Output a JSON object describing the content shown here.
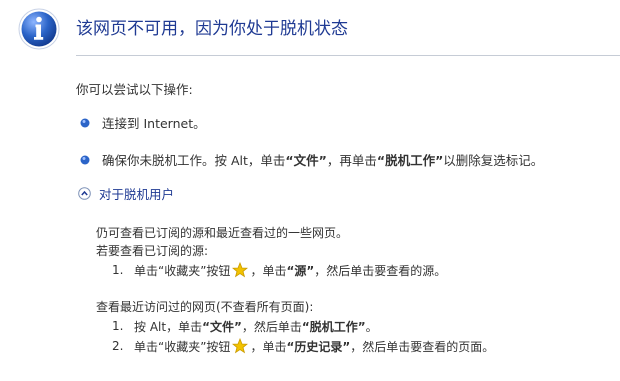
{
  "title": "该网页不可用，因为你处于脱机状态",
  "intro": "你可以尝试以下操作:",
  "bullets": {
    "b1": "连接到 Internet。",
    "b2_pre": "确保你未脱机工作。按 Alt，单击",
    "b2_file": "“文件”",
    "b2_mid": "，再单击",
    "b2_offline": "“脱机工作”",
    "b2_post": "以删除复选标记。"
  },
  "expander_label": "对于脱机用户",
  "offline": {
    "p1": "仍可查看已订阅的源和最近查看过的一些网页。",
    "p2": "若要查看已订阅的源:",
    "feeds_step": {
      "num": "1.",
      "pre": "单击“收藏夹”按钮",
      "post_a": "，单击",
      "feed": "“源”",
      "post_b": "，然后单击要查看的源。"
    },
    "p3": "查看最近访问过的网页(不查看所有页面):",
    "recent_step1": {
      "num": "1.",
      "pre": "按 Alt，单击",
      "file": "“文件”",
      "mid": "，然后单击",
      "offline": "“脱机工作”",
      "post": "。"
    },
    "recent_step2": {
      "num": "2.",
      "pre": "单击“收藏夹”按钮",
      "post_a": "，单击",
      "history": "“历史记录”",
      "post_b": "，然后单击要查看的页面。"
    }
  },
  "colors": {
    "title": "#1f3a93",
    "rule": "#c6ccd6",
    "text": "#333333",
    "icon_blue": "#2b64c8",
    "star": "#f2c200"
  },
  "icons": {
    "header": "info-icon",
    "bullet": "blue-bullet-icon",
    "expander": "collapse-arrow-icon",
    "favorites": "star-icon"
  }
}
